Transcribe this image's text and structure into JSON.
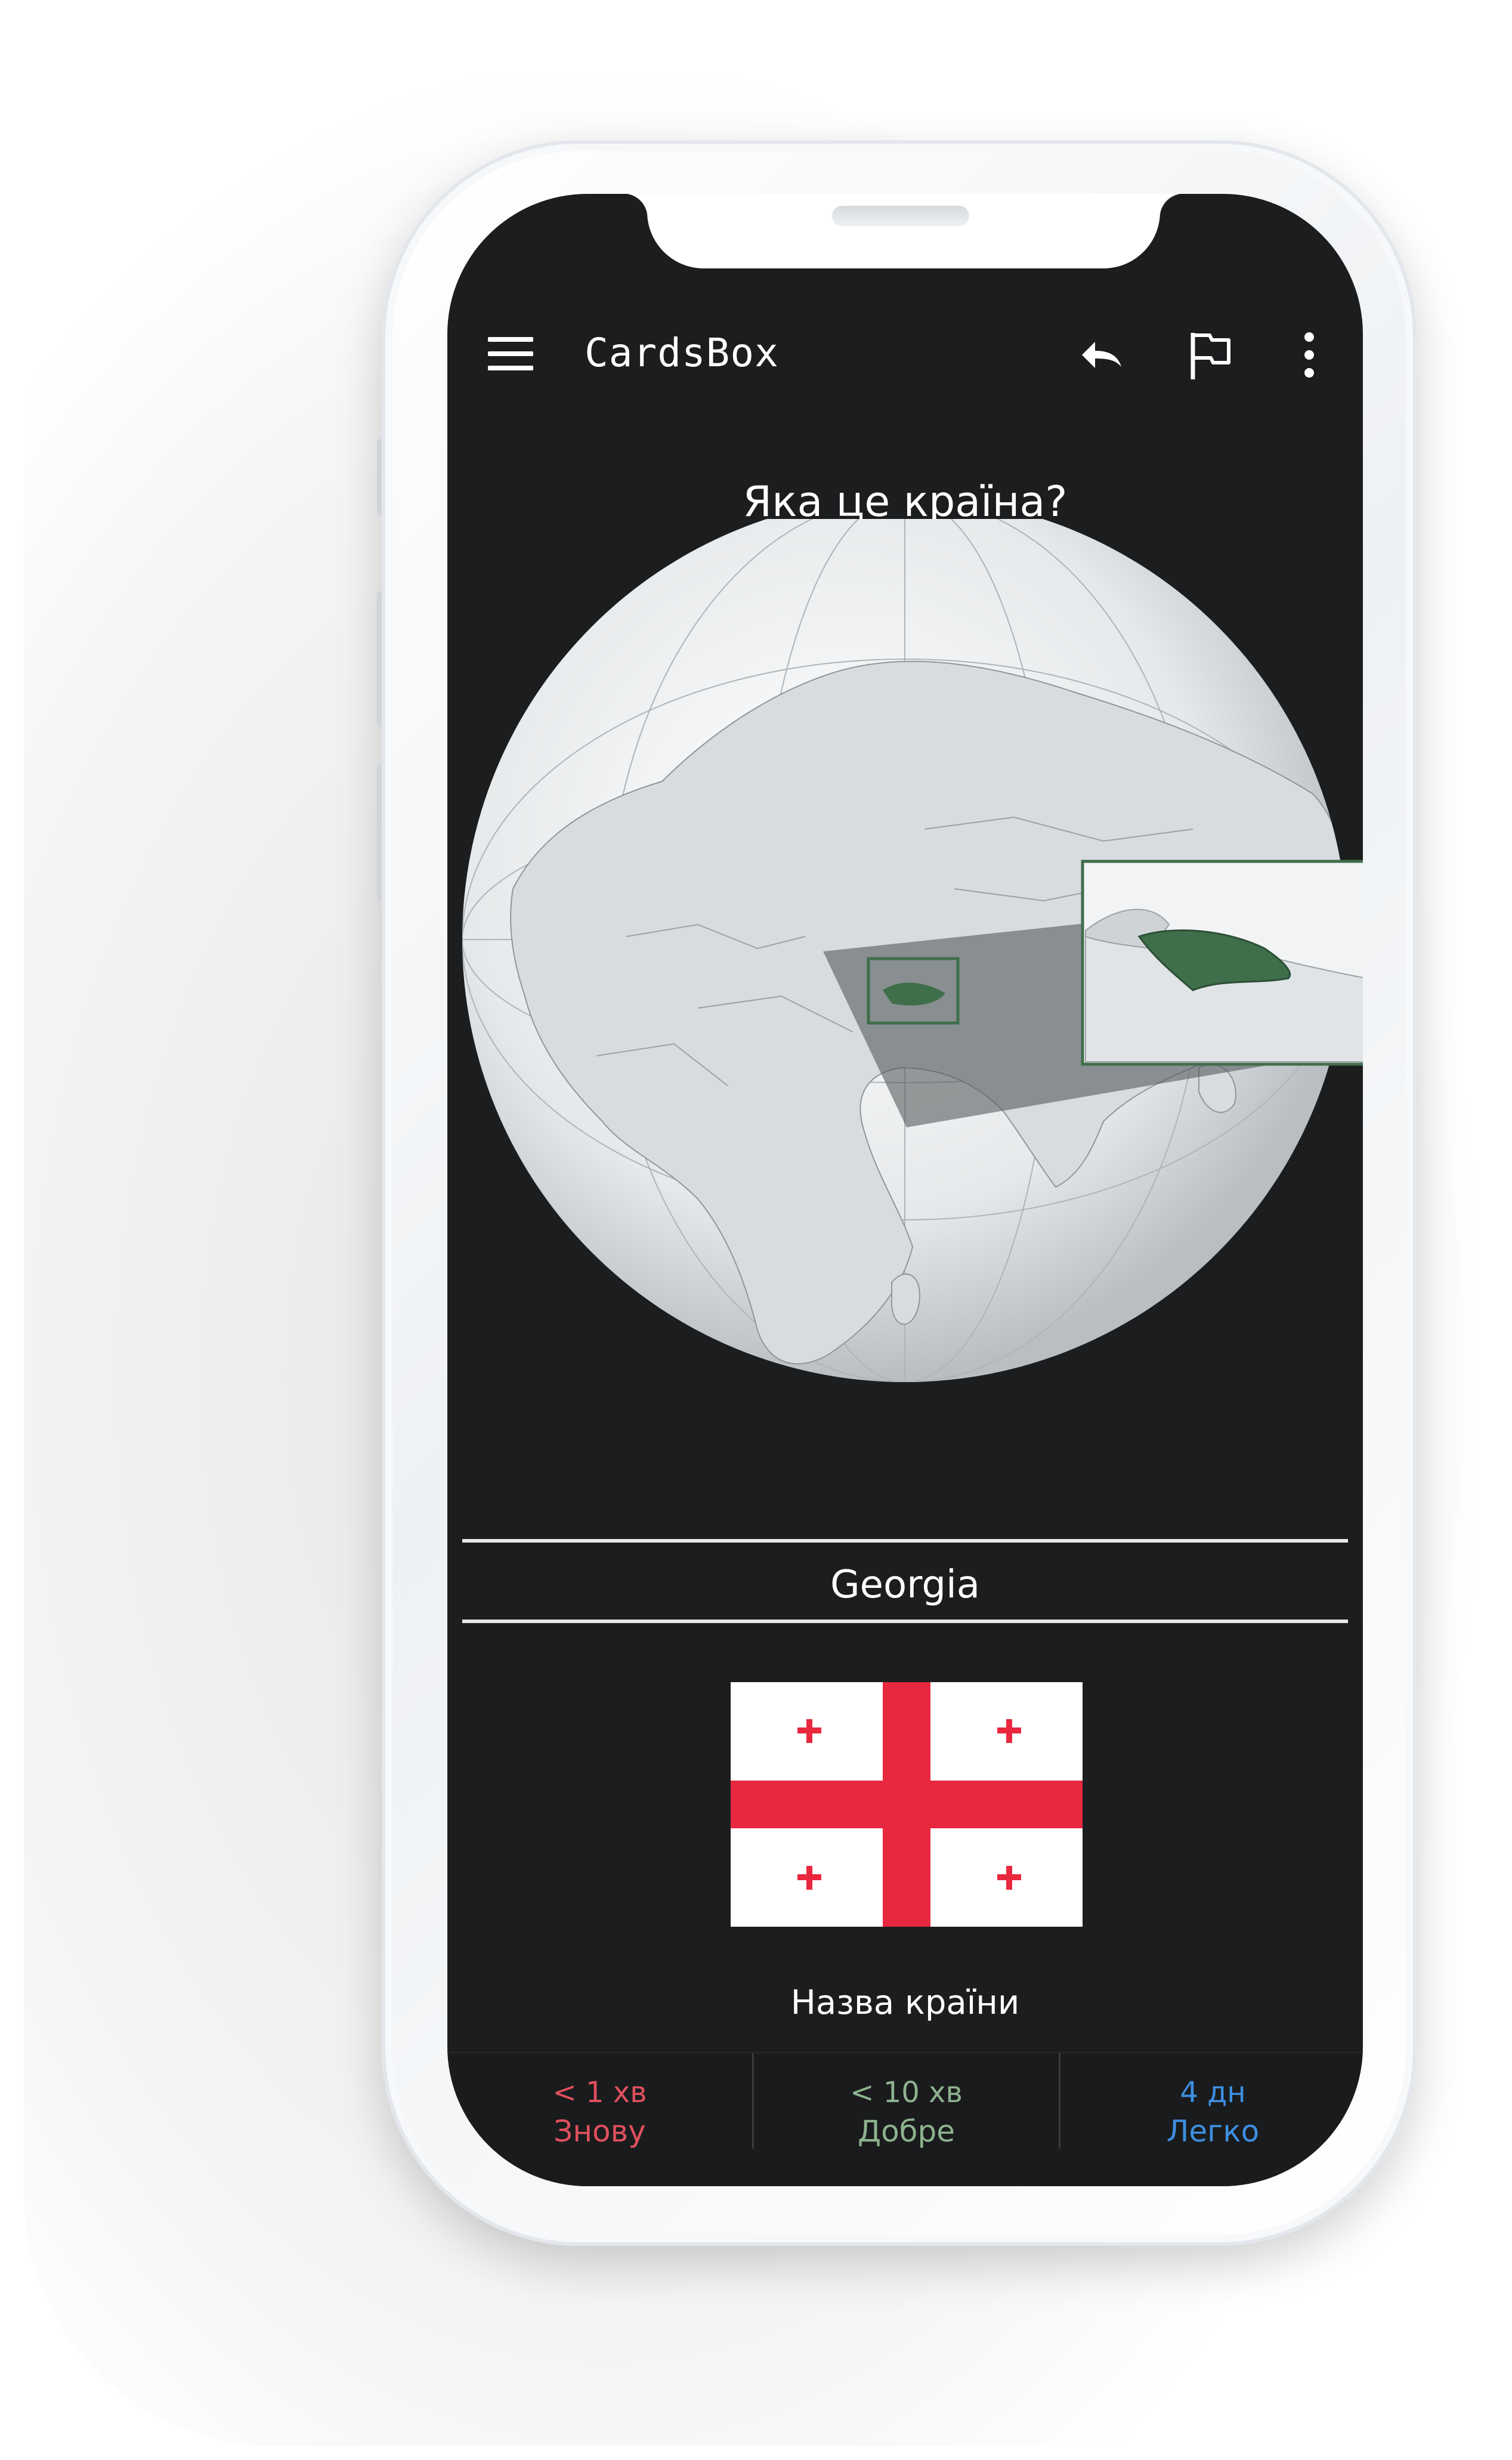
{
  "app": {
    "title": "CardsBox"
  },
  "toolbar": {
    "menu_icon": "hamburger-menu-icon",
    "undo_icon": "undo-icon",
    "flag_icon": "flag-outline-icon",
    "more_icon": "more-vert-icon"
  },
  "card": {
    "question": "Яка це країна?",
    "answer": "Georgia",
    "subtitle": "Назва країни"
  },
  "answer_buttons": [
    {
      "interval": "< 1 хв",
      "label": "Знову",
      "color": "#e0505d"
    },
    {
      "interval": "< 10 хв",
      "label": "Добре",
      "color": "#8db38e"
    },
    {
      "interval": "4 дн",
      "label": "Легко",
      "color": "#3d8fe0"
    }
  ],
  "colors": {
    "screen_bg": "#1c1d1f",
    "highlight_country": "#3f6e4a",
    "flag_red": "#e8283f",
    "flag_white": "#ffffff"
  }
}
